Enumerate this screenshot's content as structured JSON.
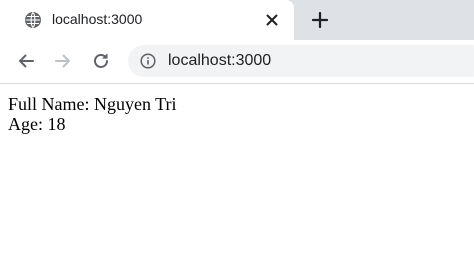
{
  "tab": {
    "title": "localhost:3000",
    "favicon_icon": "globe-icon",
    "close_icon": "close-icon"
  },
  "tabstrip": {
    "new_tab_icon": "plus-icon"
  },
  "toolbar": {
    "back_icon": "arrow-left-icon",
    "forward_icon": "arrow-right-icon",
    "reload_icon": "reload-icon",
    "site_info_icon": "info-icon",
    "url": "localhost:3000"
  },
  "page": {
    "full_name": "Full Name: Nguyen Tri",
    "age": "Age: 18"
  },
  "colors": {
    "tabstrip_bg": "#dee1e6",
    "omnibox_bg": "#f1f3f4",
    "icon_color": "#5f6368",
    "forward_disabled_color": "#bdc1c6"
  }
}
